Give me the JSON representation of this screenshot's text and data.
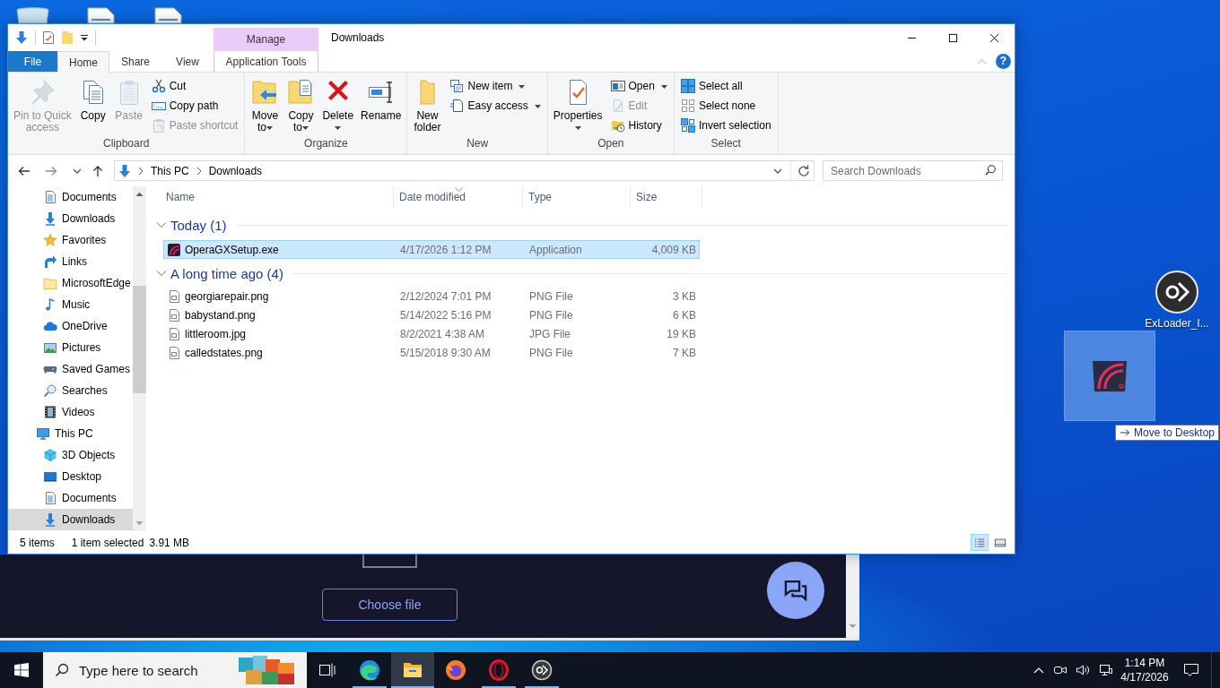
{
  "desktop": {
    "shortcut_label": "ExLoader_I...",
    "drag_tooltip": "Move to Desktop"
  },
  "browser_window": {
    "button": "Choose file"
  },
  "explorer": {
    "title": "Downloads",
    "help": "?",
    "tabs": [
      {
        "label": "File",
        "kind": "file",
        "selected": false
      },
      {
        "label": "Home",
        "kind": "tab",
        "selected": true
      },
      {
        "label": "Share",
        "kind": "tab",
        "selected": false
      },
      {
        "label": "View",
        "kind": "tab",
        "selected": false
      },
      {
        "label": "Application Tools",
        "kind": "contextual",
        "header": "Manage",
        "selected": false
      }
    ],
    "ribbon": [
      {
        "label": "Clipboard",
        "large_buttons": [
          {
            "label": "Pin to Quick access",
            "kind": "pin",
            "disabled": true,
            "dropdown": false
          },
          {
            "label": "Copy",
            "kind": "copy",
            "disabled": false,
            "dropdown": false
          },
          {
            "label": "Paste",
            "kind": "paste",
            "disabled": true,
            "dropdown": false
          }
        ],
        "small_buttons": [
          {
            "label": "Cut",
            "kind": "cut",
            "disabled": false,
            "dropdown": false
          },
          {
            "label": "Copy path",
            "kind": "copypath",
            "disabled": false,
            "dropdown": false
          },
          {
            "label": "Paste shortcut",
            "kind": "pasteshortcut",
            "disabled": true,
            "dropdown": false
          }
        ]
      },
      {
        "label": "Organize",
        "large_buttons": [
          {
            "label": "Move to",
            "kind": "moveto",
            "disabled": false,
            "dropdown": true
          },
          {
            "label": "Copy to",
            "kind": "copyto",
            "disabled": false,
            "dropdown": true
          },
          {
            "label": "Delete",
            "kind": "delete",
            "disabled": false,
            "dropdown": true
          },
          {
            "label": "Rename",
            "kind": "rename",
            "disabled": false,
            "dropdown": false
          }
        ]
      },
      {
        "label": "New",
        "large_buttons": [
          {
            "label": "New folder",
            "kind": "newfolder",
            "disabled": false,
            "dropdown": false
          }
        ],
        "small_buttons": [
          {
            "label": "New item",
            "kind": "newitem",
            "disabled": false,
            "dropdown": true
          },
          {
            "label": "Easy access",
            "kind": "easyaccess",
            "disabled": false,
            "dropdown": true
          }
        ]
      },
      {
        "label": "Open",
        "large_buttons": [
          {
            "label": "Properties",
            "kind": "properties",
            "disabled": false,
            "dropdown": true
          }
        ],
        "small_buttons": [
          {
            "label": "Open",
            "kind": "open",
            "disabled": false,
            "dropdown": true
          },
          {
            "label": "Edit",
            "kind": "edit",
            "disabled": true,
            "dropdown": false
          },
          {
            "label": "History",
            "kind": "history",
            "disabled": false,
            "dropdown": false
          }
        ]
      },
      {
        "label": "Select",
        "small_buttons": [
          {
            "label": "Select all",
            "kind": "selectall",
            "disabled": false,
            "dropdown": false
          },
          {
            "label": "Select none",
            "kind": "selectnone",
            "disabled": false,
            "dropdown": false
          },
          {
            "label": "Invert selection",
            "kind": "invert",
            "disabled": false,
            "dropdown": false
          }
        ]
      }
    ],
    "address_bar": {
      "nav_buttons": [
        {
          "kind": "back",
          "disabled": false
        },
        {
          "kind": "forward",
          "disabled": true
        },
        {
          "kind": "recent",
          "disabled": false
        },
        {
          "kind": "up",
          "disabled": false
        }
      ],
      "path": [
        "This PC",
        "Downloads"
      ]
    },
    "search": {
      "placeholder": "Search Downloads"
    },
    "nav_pane": {
      "items": [
        {
          "children": [
            {
              "label": "Documents",
              "kind": "documents",
              "selected": false
            },
            {
              "label": "Downloads",
              "kind": "download",
              "selected": false
            },
            {
              "label": "Favorites",
              "kind": "star",
              "selected": false
            },
            {
              "label": "Links",
              "kind": "links",
              "selected": false
            },
            {
              "label": "MicrosoftEdge",
              "kind": "folder",
              "selected": false
            },
            {
              "label": "Music",
              "kind": "music",
              "selected": false
            },
            {
              "label": "OneDrive",
              "kind": "cloud",
              "selected": false
            },
            {
              "label": "Pictures",
              "kind": "pictures",
              "selected": false
            },
            {
              "label": "Saved Games",
              "kind": "games",
              "selected": false
            },
            {
              "label": "Searches",
              "kind": "search",
              "selected": false
            },
            {
              "label": "Videos",
              "kind": "videos",
              "selected": false
            }
          ]
        },
        {
          "label": "This PC",
          "kind": "computer",
          "selected": false,
          "children": [
            {
              "label": "3D Objects",
              "kind": "cube",
              "selected": false
            },
            {
              "label": "Desktop",
              "kind": "desktop",
              "selected": false
            },
            {
              "label": "Documents",
              "kind": "documents",
              "selected": false
            },
            {
              "label": "Downloads",
              "kind": "download",
              "selected": true
            }
          ]
        }
      ]
    },
    "file_list": {
      "columns": [
        {
          "label": "Name",
          "sorted": false
        },
        {
          "label": "Date modified",
          "sorted": true
        },
        {
          "label": "Type",
          "sorted": false
        },
        {
          "label": "Size",
          "sorted": false
        }
      ],
      "groups": [
        {
          "label": "Today (1)",
          "expanded": true,
          "rows": [
            {
              "name": "OperaGXSetup.exe",
              "kind": "app",
              "date": "4/17/2026 1:12 PM",
              "type": "Application",
              "size": "4,009 KB",
              "selected": true
            }
          ]
        },
        {
          "label": "A long time ago (4)",
          "expanded": true,
          "rows": [
            {
              "name": "georgiarepair.png",
              "kind": "image",
              "date": "2/12/2024 7:01 PM",
              "type": "PNG File",
              "size": "3 KB",
              "selected": false
            },
            {
              "name": "babystand.png",
              "kind": "image",
              "date": "5/14/2022 5:16 PM",
              "type": "PNG File",
              "size": "6 KB",
              "selected": false
            },
            {
              "name": "littleroom.jpg",
              "kind": "image",
              "date": "8/2/2021 4:38 AM",
              "type": "JPG File",
              "size": "19 KB",
              "selected": false
            },
            {
              "name": "calledstates.png",
              "kind": "image",
              "date": "5/15/2018 9:30 AM",
              "type": "PNG File",
              "size": "7 KB",
              "selected": false
            }
          ]
        }
      ]
    },
    "status_bar": {
      "item_count": "5 items",
      "selection": "1 item selected",
      "selection_size": "3.91 MB",
      "views": [
        {
          "kind": "details",
          "selected": true
        },
        {
          "kind": "tiles",
          "selected": false
        }
      ]
    }
  },
  "taskbar": {
    "search": {
      "placeholder": "Type here to search"
    },
    "apps": [
      {
        "kind": "swirl",
        "running": true,
        "selected": false
      },
      {
        "kind": "folder",
        "running": true,
        "selected": true
      },
      {
        "kind": "globe",
        "running": false,
        "selected": false
      },
      {
        "kind": "ring",
        "running": true,
        "selected": false
      },
      {
        "kind": "disc",
        "running": true,
        "selected": false
      }
    ],
    "clock": {
      "time": "1:14 PM",
      "date": "4/17/2026"
    }
  }
}
